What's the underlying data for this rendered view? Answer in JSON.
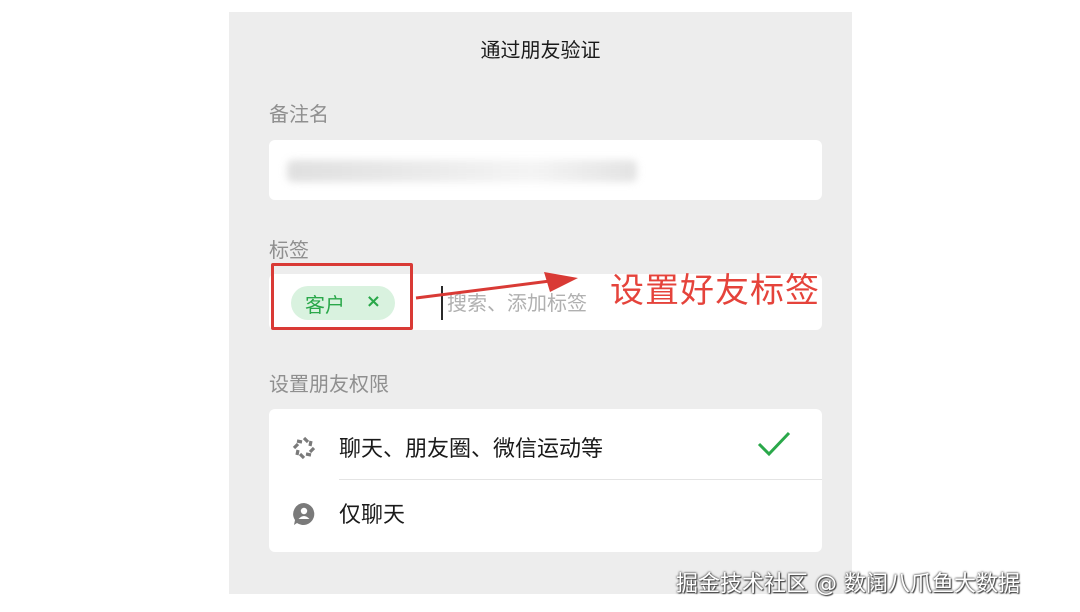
{
  "dialog": {
    "title": "通过朋友验证"
  },
  "remark": {
    "label": "备注名",
    "value_hidden": true
  },
  "tags": {
    "label": "标签",
    "chips": [
      {
        "label": "客户",
        "remove_icon": "×"
      }
    ],
    "search_placeholder": "搜索、添加标签"
  },
  "permissions": {
    "label": "设置朋友权限",
    "options": [
      {
        "label": "聊天、朋友圈、微信运动等",
        "icon": "moments-icon",
        "selected": true
      },
      {
        "label": "仅聊天",
        "icon": "chat-only-icon",
        "selected": false
      }
    ]
  },
  "annotation": {
    "text": "设置好友标签",
    "color": "#e5433b"
  },
  "watermark": {
    "text": "掘金技术社区 @ 数阔八爪鱼大数据"
  },
  "colors": {
    "accent_green": "#2aa84a",
    "chip_bg": "#d9f2df",
    "highlight_red": "#d93a35",
    "panel_bg": "#ededed"
  }
}
